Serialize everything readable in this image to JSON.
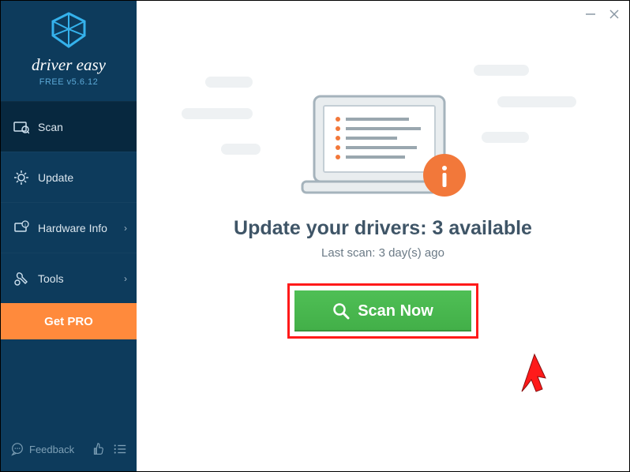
{
  "app": {
    "brand": "driver easy",
    "version": "FREE v5.6.12"
  },
  "sidebar": {
    "items": [
      {
        "label": "Scan"
      },
      {
        "label": "Update"
      },
      {
        "label": "Hardware Info"
      },
      {
        "label": "Tools"
      }
    ],
    "get_pro": "Get PRO",
    "feedback": "Feedback"
  },
  "main": {
    "headline": "Update your drivers: 3 available",
    "subline": "Last scan: 3 day(s) ago",
    "scan_button": "Scan Now"
  },
  "colors": {
    "accent": "#ff8a3c",
    "primary": "#0d3b5c",
    "green": "#4fbf55",
    "highlight": "#ff1a1a"
  }
}
